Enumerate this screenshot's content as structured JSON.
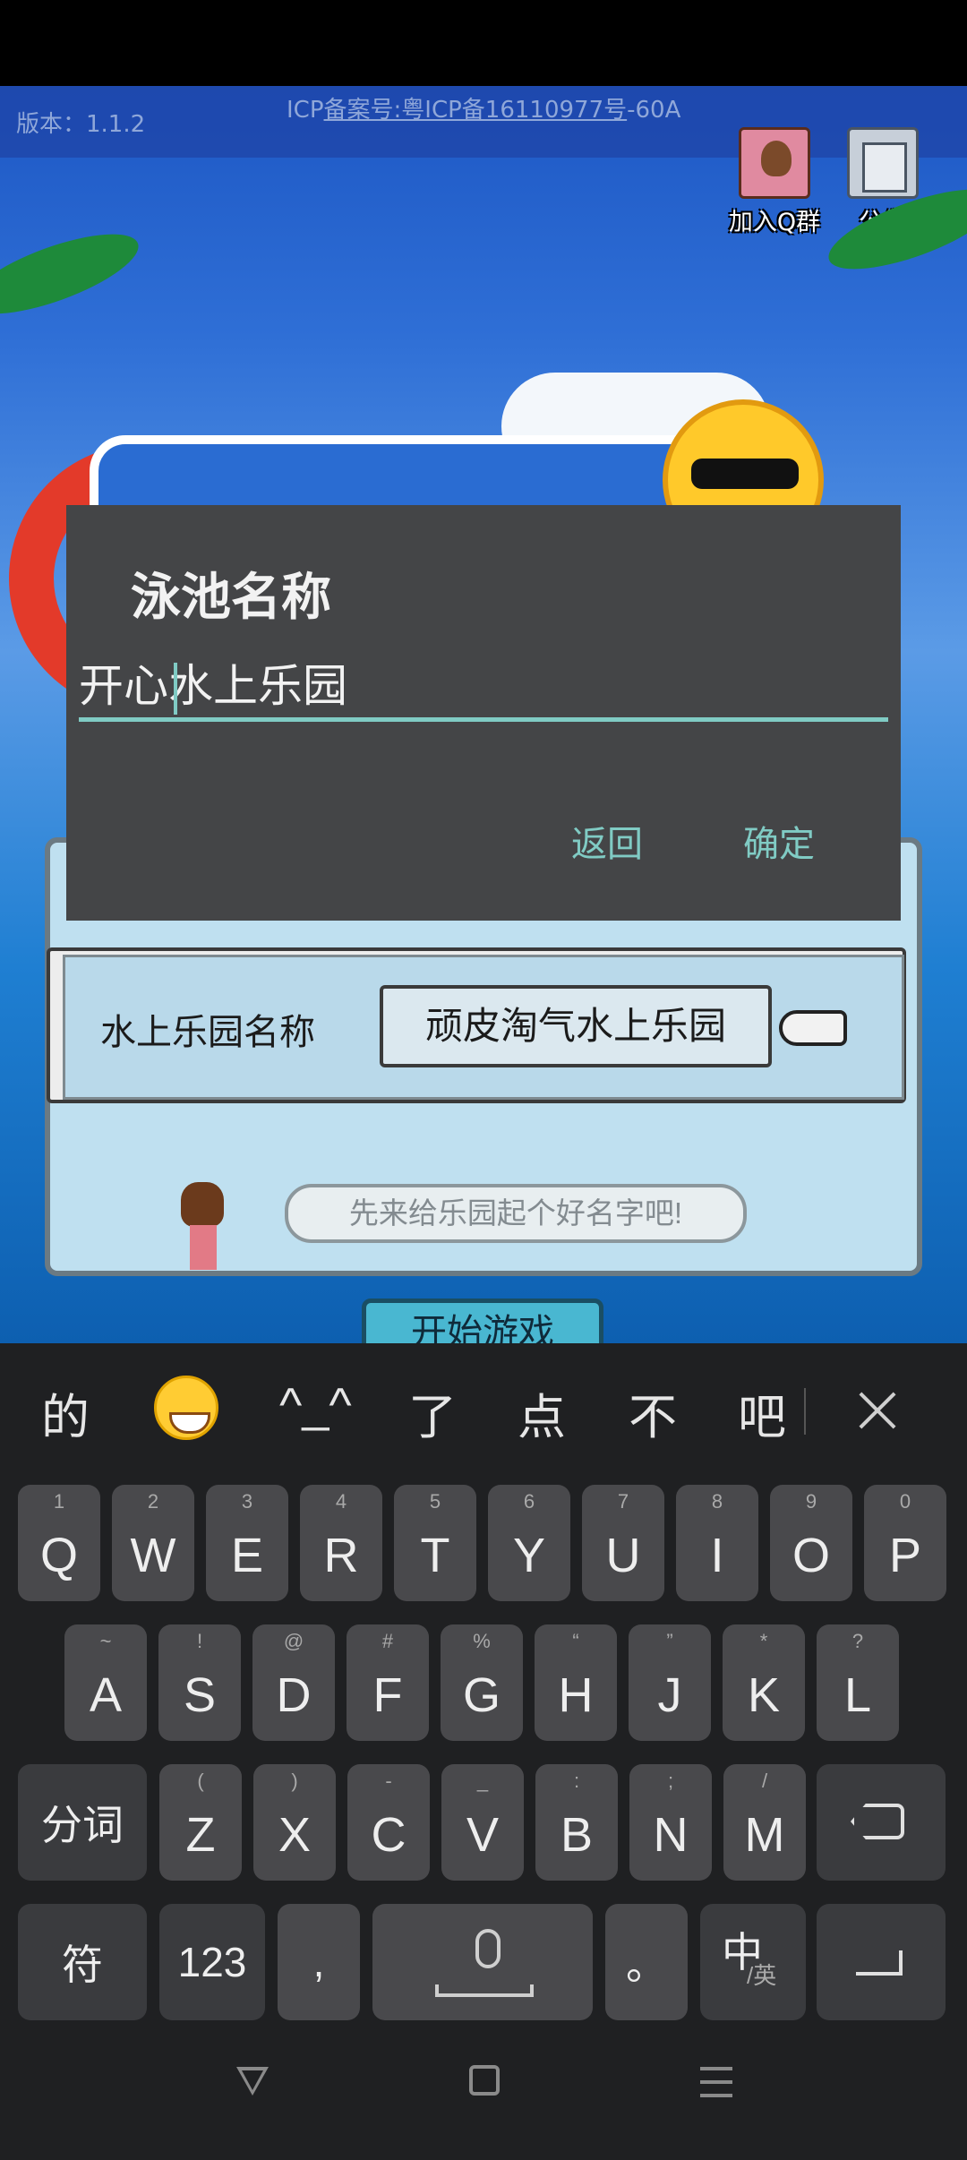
{
  "game": {
    "version": "版本：1.1.2",
    "icp_prefix": "ICP",
    "icp_link": "备案号:粤ICP备16110977号",
    "icp_suffix": "-60A",
    "join_qq_label": "加入Q群",
    "notice_label": "公告",
    "park_name_label": "水上乐园名称",
    "park_name_value": "顽皮淘气水上乐园",
    "speech_text": "先来给乐园起个好名字吧!",
    "start_button": "开始游戏"
  },
  "dialog": {
    "title": "泳池名称",
    "input_value": "开心水上乐园",
    "back_label": "返回",
    "ok_label": "确定",
    "accent_color": "#80cbc4"
  },
  "keyboard": {
    "candidates": [
      "的",
      "^_^",
      "了",
      "点",
      "不",
      "吧"
    ],
    "candidate_emoji": "grinning-face-emoji",
    "row1": [
      {
        "k": "Q",
        "h": "1"
      },
      {
        "k": "W",
        "h": "2"
      },
      {
        "k": "E",
        "h": "3"
      },
      {
        "k": "R",
        "h": "4"
      },
      {
        "k": "T",
        "h": "5"
      },
      {
        "k": "Y",
        "h": "6"
      },
      {
        "k": "U",
        "h": "7"
      },
      {
        "k": "I",
        "h": "8"
      },
      {
        "k": "O",
        "h": "9"
      },
      {
        "k": "P",
        "h": "0"
      }
    ],
    "row2": [
      {
        "k": "A",
        "h": "~"
      },
      {
        "k": "S",
        "h": "!"
      },
      {
        "k": "D",
        "h": "@"
      },
      {
        "k": "F",
        "h": "#"
      },
      {
        "k": "G",
        "h": "%"
      },
      {
        "k": "H",
        "h": "“"
      },
      {
        "k": "J",
        "h": "”"
      },
      {
        "k": "K",
        "h": "*"
      },
      {
        "k": "L",
        "h": "?"
      }
    ],
    "row3": [
      {
        "k": "Z",
        "h": "("
      },
      {
        "k": "X",
        "h": ")"
      },
      {
        "k": "C",
        "h": "-"
      },
      {
        "k": "V",
        "h": "_"
      },
      {
        "k": "B",
        "h": ":"
      },
      {
        "k": "N",
        "h": ";"
      },
      {
        "k": "M",
        "h": "/"
      }
    ],
    "fenci": "分词",
    "symbol": "符",
    "num": "123",
    "comma": ",",
    "period": "。",
    "lang_main": "中",
    "lang_sub": "/英"
  }
}
